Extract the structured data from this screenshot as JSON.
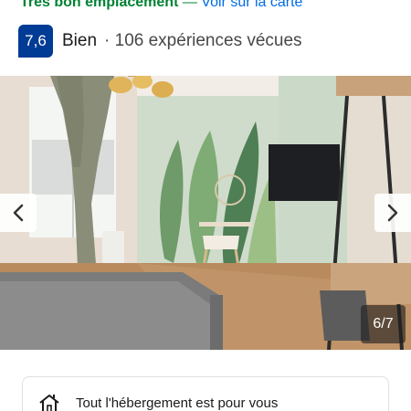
{
  "location": {
    "label": "Très bon emplacement",
    "separator": "—",
    "map_link": "Voir sur la carte"
  },
  "rating": {
    "score": "7,6",
    "word": "Bien",
    "reviews": "· 106 expériences vécues"
  },
  "gallery": {
    "counter": "6/7",
    "prev_icon": "chevron-left-icon",
    "next_icon": "chevron-right-icon"
  },
  "card": {
    "icon": "house-icon",
    "text": "Tout l'hébergement est pour vous"
  },
  "colors": {
    "location_green": "#008234",
    "link_blue": "#006ce4",
    "badge_blue": "#003b95"
  }
}
